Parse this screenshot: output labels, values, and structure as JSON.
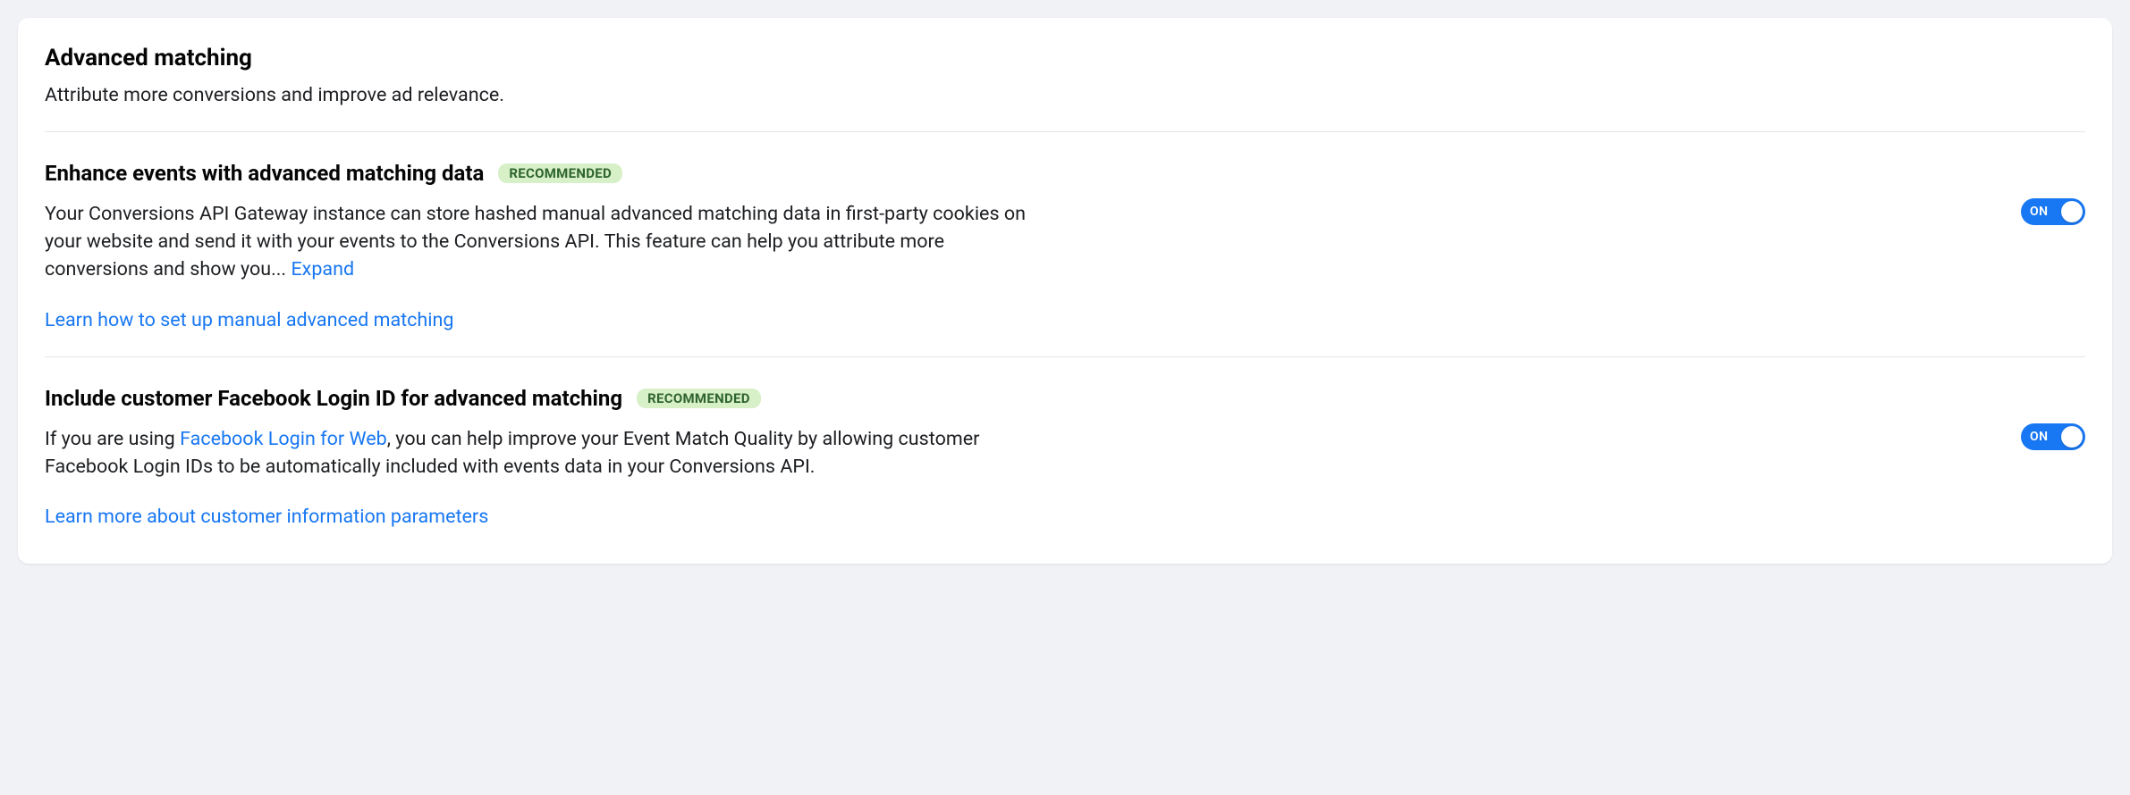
{
  "header": {
    "title": "Advanced matching",
    "subtitle": "Attribute more conversions and improve ad relevance."
  },
  "settings": {
    "enhance": {
      "heading": "Enhance events with advanced matching data",
      "badge": "RECOMMENDED",
      "description_pre": "Your Conversions API Gateway instance can store hashed manual advanced matching data in first-party cookies on your website and send it with your events to the Conversions API. This feature can help you attribute more conversions and show you... ",
      "expand_label": "Expand",
      "secondary_link": "Learn how to set up manual advanced matching",
      "toggle_label": "ON"
    },
    "loginId": {
      "heading": "Include customer Facebook Login ID for advanced matching",
      "badge": "RECOMMENDED",
      "desc_before_link": "If you are using ",
      "inline_link": "Facebook Login for Web",
      "desc_after_link": ", you can help improve your Event Match Quality by allowing customer Facebook Login IDs to be automatically included with events data in your Conversions API.",
      "secondary_link": "Learn more about customer information parameters",
      "toggle_label": "ON"
    }
  }
}
